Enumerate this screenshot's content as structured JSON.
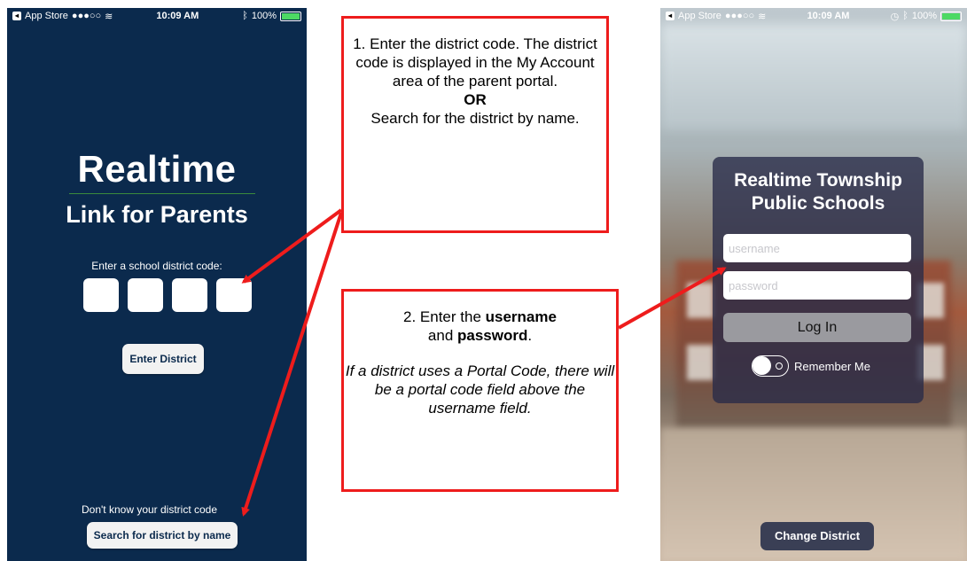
{
  "left_phone": {
    "status": {
      "carrier": "App Store",
      "signal": "●●●○○",
      "time": "10:09 AM",
      "battery": "100%"
    },
    "brand_title": "Realtime",
    "brand_subtitle": "Link for Parents",
    "code_label": "Enter a school district code:",
    "enter_button": "Enter District",
    "dont_know": "Don't know your district code",
    "search_button": "Search for district by name"
  },
  "callout1": {
    "line1": "1. Enter the district code. The district code is displayed in the My Account area of the parent portal.",
    "or": "OR",
    "line2": "Search for the district by name."
  },
  "callout2": {
    "prefix": "2. Enter the ",
    "username": "username",
    "middle": " and ",
    "password": "password",
    "suffix": ".",
    "note": "If a district uses a Portal Code, there will be a portal code field above the username field."
  },
  "right_phone": {
    "status": {
      "carrier": "App Store",
      "signal": "●●●○○",
      "time": "10:09 AM",
      "battery": "100%"
    },
    "school_name": "Realtime Township Public Schools",
    "username_placeholder": "username",
    "password_placeholder": "password",
    "login_button": "Log In",
    "remember_label": "Remember Me",
    "change_button": "Change District"
  },
  "colors": {
    "arrow": "#ee1c1c",
    "navy": "#0b2a4d",
    "accent_green": "#3a8a3c"
  }
}
